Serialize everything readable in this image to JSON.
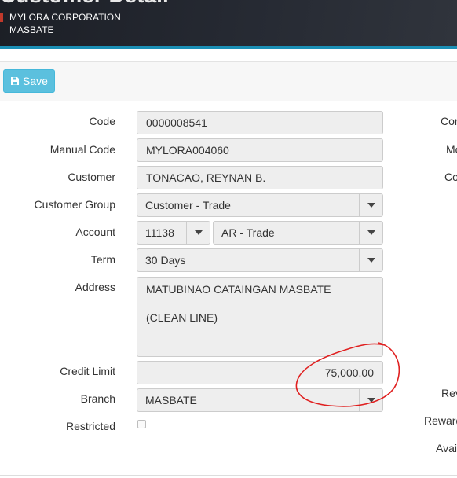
{
  "header": {
    "title": "Customer Detail",
    "company": "MYLORA CORPORATION",
    "branch": "MASBATE"
  },
  "toolbar": {
    "save_label": "Save",
    "save_icon": "floppy-disk-icon"
  },
  "form": {
    "code_label": "Code",
    "code_value": "0000008541",
    "manual_code_label": "Manual Code",
    "manual_code_value": "MYLORA004060",
    "customer_label": "Customer",
    "customer_value": "TONACAO, REYNAN B.",
    "customer_group_label": "Customer Group",
    "customer_group_value": "Customer - Trade",
    "account_label": "Account",
    "account_code_value": "11138",
    "account_name_value": "AR - Trade",
    "term_label": "Term",
    "term_value": "30 Days",
    "address_label": "Address",
    "address_line1": "MATUBINAO CATAINGAN MASBATE",
    "address_line2": "(CLEAN LINE)",
    "credit_limit_label": "Credit Limit",
    "credit_limit_value": "75,000.00",
    "branch_label": "Branch",
    "branch_value": "MASBATE",
    "restricted_label": "Restricted",
    "restricted_checked": false
  },
  "right_column": {
    "label_1": "Cor",
    "label_2": "Mo",
    "label_3": "Co",
    "label_4": "Rev",
    "label_5": "Reward",
    "label_6": "Avai"
  },
  "annotation": {
    "color": "#e02020",
    "target": "credit_limit_value"
  }
}
